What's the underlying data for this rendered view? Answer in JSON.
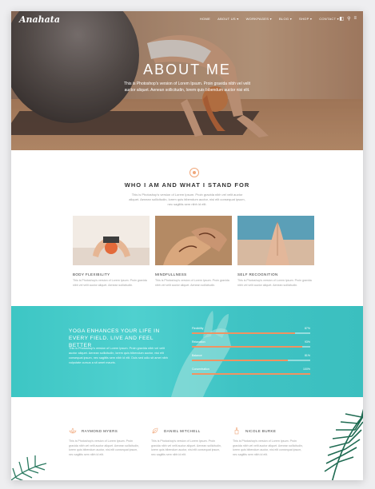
{
  "nav": {
    "logo": "Anahata",
    "menu": [
      "HOME",
      "ABOUT US ▾",
      "WORKPAGES ▾",
      "BLOG ▾",
      "SHOP ▾",
      "CONTACT ▾"
    ],
    "icons": [
      "cart-icon",
      "search-icon",
      "menu-icon"
    ]
  },
  "hero": {
    "title": "ABOUT ME",
    "subtitle": "This is Photoshop's version of Lorem Ipsum. Proin gravida nibh vel velit auctor aliquet. Aenean sollicitudin, lorem quis bibendum auctor nisi elit."
  },
  "who": {
    "title": "WHO I AM AND WHAT I STAND FOR",
    "text": "This is Photoshop's version of Lorem Ipsum. Proin gravida nibh vel velit auctor aliquet. Aenean sollicitudin, lorem quis bibendum auctor, nisi elit consequat ipsum, nec sagittis sem nibh id elit.",
    "cards": [
      {
        "title": "BODY FLEXIBILITY",
        "desc": "This is Photoshop's version of Lorem Ipsum. Proin gravida nibh vel velit auctor aliquet. Aenean sollicitudin."
      },
      {
        "title": "MINDFULLNESS",
        "desc": "This is Photoshop's version of Lorem Ipsum. Proin gravida nibh vel velit auctor aliquet. Aenean sollicitudin."
      },
      {
        "title": "SELF RECOGNITION",
        "desc": "This is Photoshop's version of Lorem Ipsum. Proin gravida nibh vel velit auctor aliquet. Aenean sollicitudin."
      }
    ]
  },
  "band": {
    "title": "YOGA ENHANCES YOUR LIFE IN EVERY FIELD. LIVE AND FEEL BETTER",
    "text": "This is Photoshop's version of Lorem Ipsum. Proin gravida nibh vel velit auctor aliquet. Aenean sollicitudin, lorem quis bibendum auctor, nisi elit consequat ipsum, nec sagittis sem nibh id elit. Duis sed odio sit amet nibh vulputate cursus a sit amet mauris.",
    "skills": [
      {
        "label": "Flexibility",
        "value": "87%",
        "pct": 87
      },
      {
        "label": "Relaxation",
        "value": "93%",
        "pct": 93
      },
      {
        "label": "Balance",
        "value": "81%",
        "pct": 81
      },
      {
        "label": "Concentration",
        "value": "100%",
        "pct": 100
      }
    ],
    "accent": "#f19361"
  },
  "testimonials": [
    {
      "name": "RAYMOND MYERS",
      "icon": "lotus-icon",
      "text": "This is Photoshop's version of Lorem Ipsum. Proin gravida nibh vel velit auctor aliquet. Aenean sollicitudin, lorem quis bibendum auctor, nisi elit consequat ipsum, nec sagittis sem nibh id elit."
    },
    {
      "name": "DANIEL MITCHELL",
      "icon": "leaf-icon",
      "text": "This is Photoshop's version of Lorem Ipsum. Proin gravida nibh vel velit auctor aliquet. Aenean sollicitudin, lorem quis bibendum auctor, nisi elit consequat ipsum, nec sagittis sem nibh id elit."
    },
    {
      "name": "NICOLE BURKE",
      "icon": "candle-icon",
      "text": "This is Photoshop's version of Lorem Ipsum. Proin gravida nibh vel velit auctor aliquet. Aenean sollicitudin, lorem quis bibendum auctor, nisi elit consequat ipsum, nec sagittis sem nibh id elit."
    }
  ]
}
